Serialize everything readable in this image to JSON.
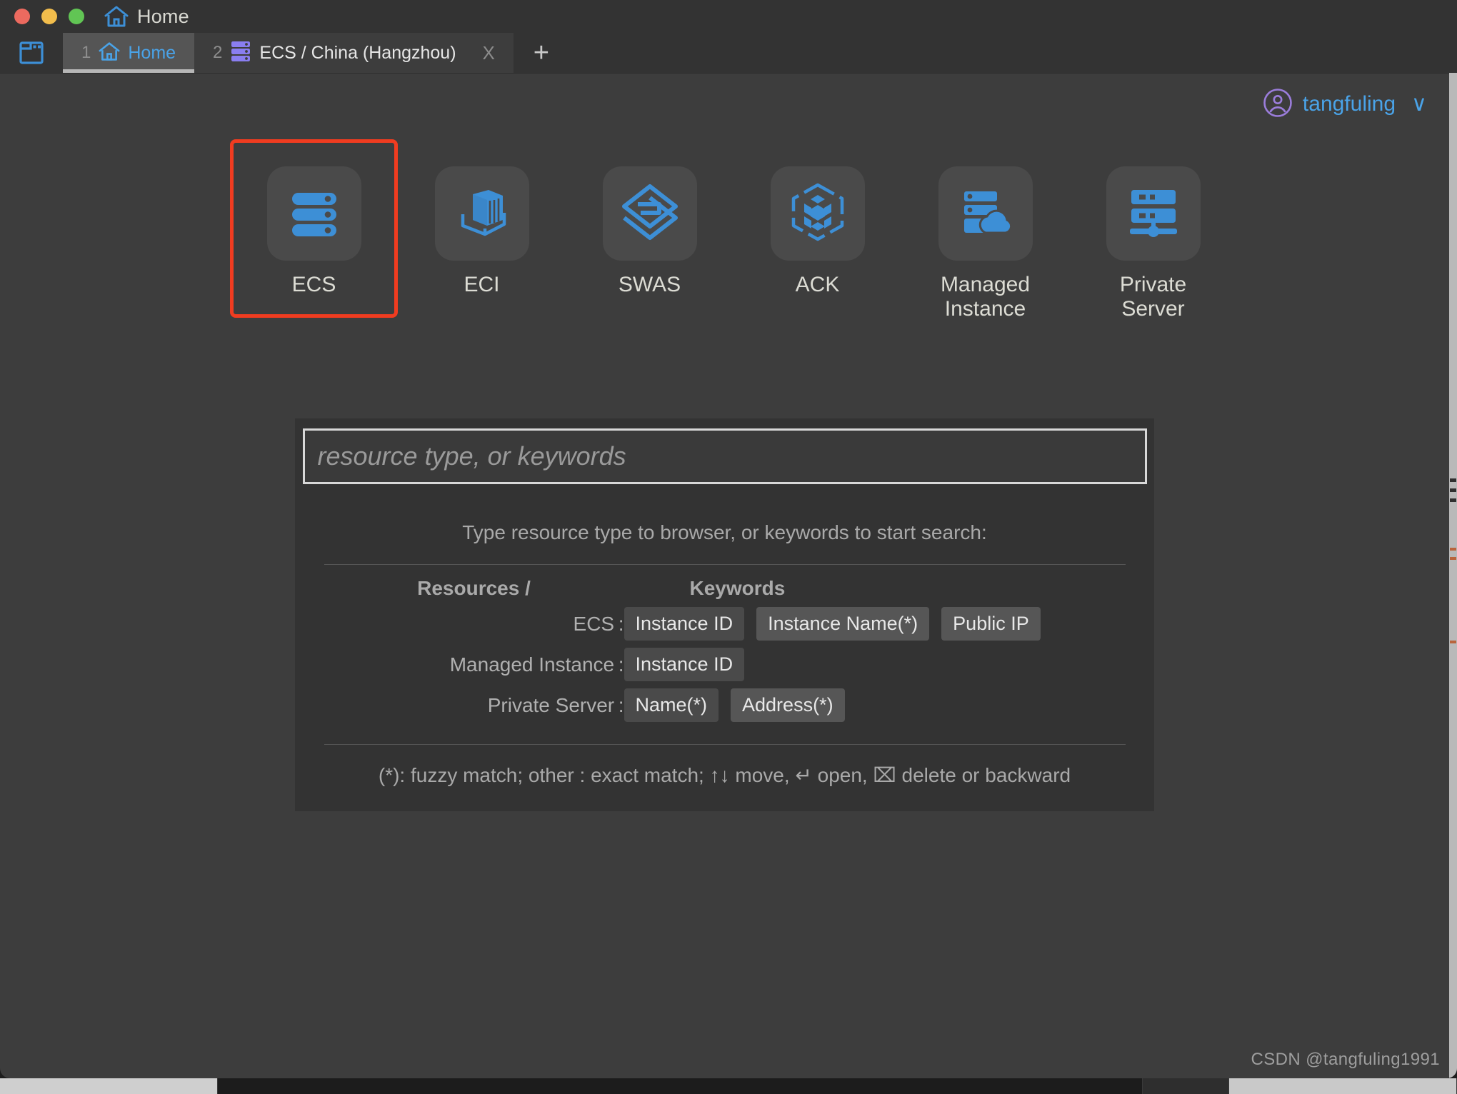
{
  "window": {
    "title": "Home",
    "title_icon": "home-icon",
    "traffic_lights": [
      "close",
      "minimize",
      "maximize"
    ]
  },
  "tabbar": {
    "panel_icon": "window-panel-icon",
    "tabs": [
      {
        "number": "1",
        "label": "Home",
        "icon": "home-icon",
        "active": true,
        "closable": false
      },
      {
        "number": "2",
        "label": "ECS / China (Hangzhou)",
        "icon": "server-stack-icon",
        "active": false,
        "closable": true,
        "close_label": "X"
      }
    ],
    "new_tab_label": "+"
  },
  "account": {
    "avatar_icon": "user-circle-icon",
    "username": "tangfuling",
    "chevron": "∨"
  },
  "resources": {
    "items": [
      {
        "label": "ECS",
        "icon": "server-stack-icon",
        "selected": true
      },
      {
        "label": "ECI",
        "icon": "container-box-icon",
        "selected": false
      },
      {
        "label": "SWAS",
        "icon": "swas-diamond-icon",
        "selected": false
      },
      {
        "label": "ACK",
        "icon": "kubernetes-cube-icon",
        "selected": false
      },
      {
        "label": "Managed Instance",
        "icon": "server-cloud-icon",
        "selected": false
      },
      {
        "label": "Private Server",
        "icon": "server-network-icon",
        "selected": false
      }
    ]
  },
  "search": {
    "value": "",
    "placeholder": "resource type, or keywords",
    "hint_title": "Type resource type to browser, or keywords to start search:",
    "headers": {
      "resources": "Resources /",
      "keywords": "Keywords"
    },
    "rows": [
      {
        "resource": "ECS :",
        "keywords": [
          "Instance ID",
          "Instance Name(*)",
          "Public IP"
        ]
      },
      {
        "resource": "Managed Instance :",
        "keywords": [
          "Instance ID"
        ]
      },
      {
        "resource": "Private Server :",
        "keywords": [
          "Name(*)",
          "Address(*)"
        ]
      }
    ],
    "footnote": "(*): fuzzy match; other : exact match; ↑↓ move, ↵ open, ⌧ delete or backward"
  },
  "watermark": "CSDN @tangfuling1991",
  "colors": {
    "accent_blue": "#4aa3e8",
    "selection_red": "#f03c20",
    "tab_purple": "#8a7ef0",
    "panel_bg": "#333333",
    "window_bg": "#3d3d3d"
  }
}
